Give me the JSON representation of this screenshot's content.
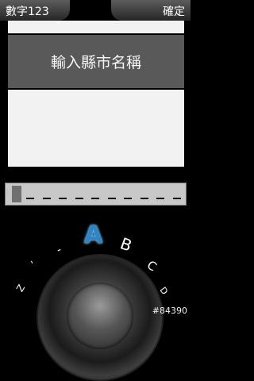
{
  "topbar": {
    "mode_label": "數字123",
    "confirm_label": "確定"
  },
  "prompt": {
    "text": "輸入縣市名稱"
  },
  "entry": {
    "slot_count": 10
  },
  "dial": {
    "selected_letter": "A",
    "next_letters": [
      "B",
      "C",
      "D"
    ],
    "prev_symbols": [
      "-",
      "'",
      "Z"
    ]
  },
  "watermark": "#84390",
  "colors": {
    "accent": "#2a86c8",
    "prompt_bg": "#595959",
    "panel_bg": "#f2f2f2",
    "entry_bg": "#c8c8c8"
  }
}
